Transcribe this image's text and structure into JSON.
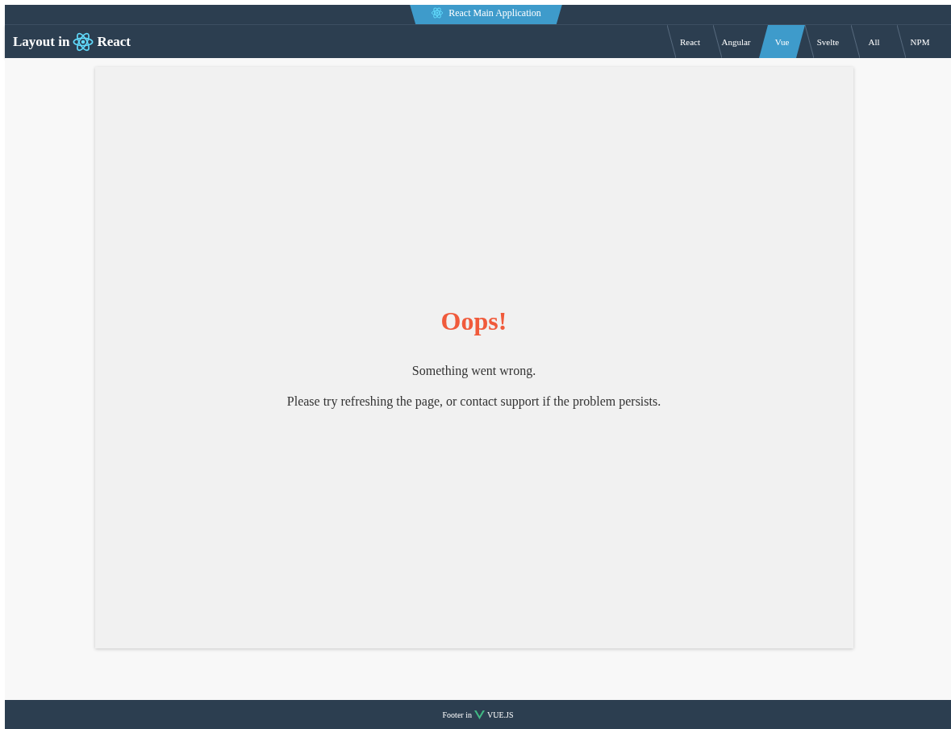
{
  "top_bar": {
    "app_tab": {
      "label": "React Main Application",
      "selected": true
    }
  },
  "header": {
    "title_prefix": "Layout in",
    "title_suffix": "React"
  },
  "nav": [
    {
      "label": "React",
      "selected": false
    },
    {
      "label": "Angular",
      "selected": false
    },
    {
      "label": "Vue",
      "selected": true
    },
    {
      "label": "Svelte",
      "selected": false
    },
    {
      "label": "All",
      "selected": false
    },
    {
      "label": "NPM",
      "selected": false
    }
  ],
  "error": {
    "heading": "Oops!",
    "message": "Something went wrong.",
    "hint": "Please try refreshing the page, or contact support if the problem persists."
  },
  "footer": {
    "prefix": "Footer in",
    "suffix": "VUE.JS"
  }
}
